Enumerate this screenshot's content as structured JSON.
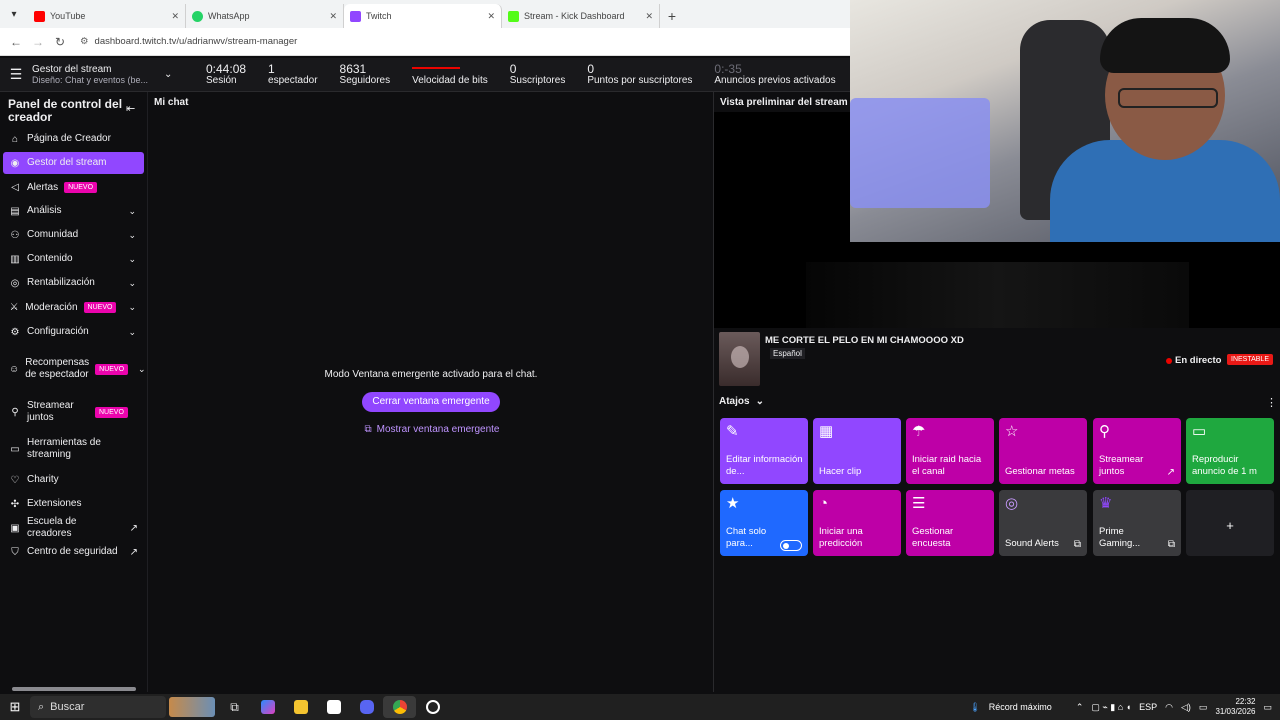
{
  "browser": {
    "tabs": [
      {
        "title": "YouTube",
        "color": "#ff0000"
      },
      {
        "title": "WhatsApp",
        "color": "#25d366"
      },
      {
        "title": "Twitch",
        "color": "#9147ff"
      },
      {
        "title": "Stream - Kick Dashboard",
        "color": "#53fc18"
      }
    ],
    "url": "dashboard.twitch.tv/u/adrianwv/stream-manager"
  },
  "topbar": {
    "title": "Gestor del stream",
    "subtitle": "Diseño: Chat y eventos (be...",
    "stats": [
      {
        "value": "0:44:08",
        "label": "Sesión"
      },
      {
        "value": "1",
        "label": "espectador"
      },
      {
        "value": "8631",
        "label": "Seguidores"
      },
      {
        "value": "",
        "label": "Velocidad de bits"
      },
      {
        "value": "0",
        "label": "Suscriptores"
      },
      {
        "value": "0",
        "label": "Puntos por suscriptores"
      },
      {
        "value": "0:-35",
        "label": "Anuncios previos activados"
      }
    ]
  },
  "sidebar": {
    "title": "Panel de control del creador",
    "new_badge": "NUEVO",
    "items": [
      {
        "label": "Página de Creador"
      },
      {
        "label": "Gestor del stream"
      },
      {
        "label": "Alertas"
      },
      {
        "label": "Análisis"
      },
      {
        "label": "Comunidad"
      },
      {
        "label": "Contenido"
      },
      {
        "label": "Rentabilización"
      },
      {
        "label": "Moderación"
      },
      {
        "label": "Configuración"
      },
      {
        "label": "Recompensas de espectador"
      },
      {
        "label": "Streamear juntos"
      },
      {
        "label": "Herramientas de streaming"
      },
      {
        "label": "Charity"
      },
      {
        "label": "Extensiones"
      },
      {
        "label": "Escuela de creadores"
      },
      {
        "label": "Centro de seguridad"
      }
    ]
  },
  "chat": {
    "title": "Mi chat",
    "popup_message": "Modo Ventana emergente activado para el chat.",
    "close_popup": "Cerrar ventana emergente",
    "show_popup": "Mostrar ventana emergente"
  },
  "preview": {
    "title": "Vista preliminar del stream",
    "stream_title": "ME CORTE EL PELO EN MI CHAMOOOO XD",
    "language": "Español",
    "live": "En directo",
    "status": "INESTABLE"
  },
  "shortcuts": {
    "title": "Atajos",
    "items": [
      {
        "label": "Editar información de...",
        "icon": "pencil-icon"
      },
      {
        "label": "Hacer clip",
        "icon": "clapper-icon"
      },
      {
        "label": "Iniciar raid hacia el canal",
        "icon": "raid-icon"
      },
      {
        "label": "Gestionar metas",
        "icon": "star-outline-icon"
      },
      {
        "label": "Streamear juntos",
        "icon": "person-plus-icon"
      },
      {
        "label": "Reproducir anuncio de 1 m",
        "icon": "ad-icon"
      },
      {
        "label": "Chat solo para...",
        "icon": "star-icon"
      },
      {
        "label": "Iniciar una predicción",
        "icon": "prediction-icon"
      },
      {
        "label": "Gestionar encuesta",
        "icon": "poll-icon"
      },
      {
        "label": "Sound Alerts",
        "icon": "sound-alerts-icon"
      },
      {
        "label": "Prime Gaming...",
        "icon": "prime-icon"
      },
      {
        "label": "+",
        "icon": "plus-icon"
      }
    ]
  },
  "taskbar": {
    "search": "Buscar",
    "record": "Récord máximo",
    "lang": "ESP",
    "time": "22:32",
    "date": "31/03/2026"
  }
}
